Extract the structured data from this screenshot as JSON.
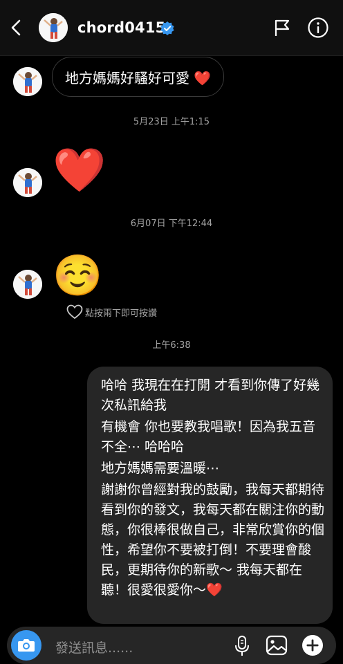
{
  "header": {
    "username": "chord0415",
    "icons": [
      "back-arrow-icon",
      "verified-badge-icon",
      "flag-icon",
      "info-icon"
    ]
  },
  "messages": {
    "received_1": "地方媽媽好騷好可愛 ❤️",
    "timestamp_1": "5月23日 上午1:15",
    "reaction_heart": "❤️",
    "timestamp_2": "6月07日 下午12:44",
    "reaction_smile": "☺️",
    "double_tap_hint": "點按兩下即可按讚",
    "timestamp_3": "上午6:38",
    "sent_lines": [
      "哈哈 我現在在打開 才看到你傳了好幾次私訊給我",
      "有機會 你也要教我唱歌！因為我五音不全⋯ 哈哈哈",
      "地方媽媽需要溫暖⋯",
      "謝謝你曾經對我的鼓勵，我每天都期待看到你的發文，我每天都在關注你的動態，你很棒很做自己，非常欣賞你的個性，希望你不要被打倒！不要理會酸民，更期待你的新歌～ 我每天都在聽！很愛很愛你～❤️"
    ]
  },
  "composer": {
    "placeholder": "發送訊息......",
    "icons": [
      "camera-icon",
      "microphone-icon",
      "gallery-icon",
      "add-icon"
    ]
  },
  "colors": {
    "accent": "#3797f0",
    "background": "#000000",
    "header": "#101010",
    "bubble_sent": "#262626",
    "muted_text": "#a3a3a3"
  }
}
